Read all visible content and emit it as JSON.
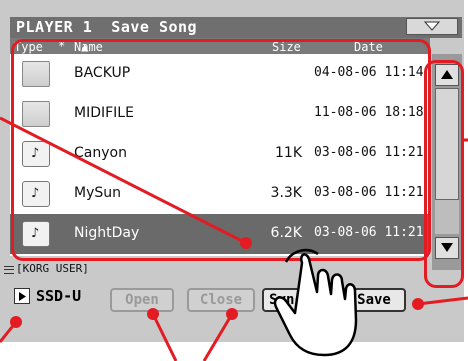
{
  "window": {
    "title": "PLAYER 1  Save Song"
  },
  "columns": {
    "type": "Type",
    "name": "Name",
    "size": "Size",
    "date": "Date"
  },
  "files": [
    {
      "kind": "folder",
      "name": "BACKUP",
      "size": "",
      "date": "04-08-06 11:14"
    },
    {
      "kind": "folder",
      "name": "MIDIFILE",
      "size": "",
      "date": "11-08-06 18:18"
    },
    {
      "kind": "song",
      "name": "Canyon",
      "size": "11K",
      "date": "03-08-06 11:21"
    },
    {
      "kind": "song",
      "name": "MySun",
      "size": "3.3K",
      "date": "03-08-06 11:21"
    },
    {
      "kind": "song",
      "name": "NightDay",
      "size": "6.2K",
      "date": "03-08-06 11:21",
      "selected": true
    }
  ],
  "path": {
    "label": "[KORG USER]"
  },
  "drive": {
    "label": "SSD-U"
  },
  "buttons": {
    "open": "Open",
    "close": "Close",
    "sync": "Sync",
    "save": "Save"
  },
  "scrollbar": {
    "position": 0.0
  },
  "colors": {
    "callout": "#e31b23",
    "header": "#6f6f6f",
    "selected_row": "#6a6a6a"
  }
}
